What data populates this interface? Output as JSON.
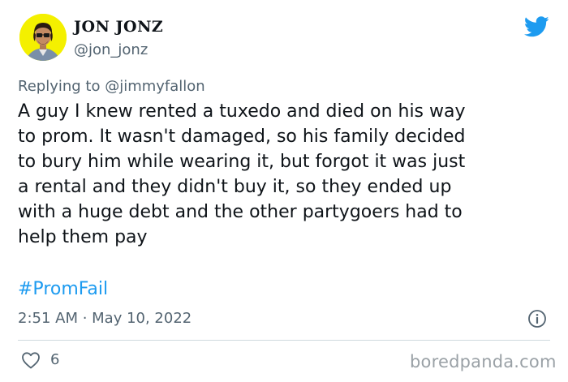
{
  "user": {
    "display_name": "JON JONZ",
    "handle": "@jon_jonz",
    "avatar_icon": "profile-avatar"
  },
  "platform_icon": "twitter-bird-icon",
  "reply": {
    "prefix": "Replying to ",
    "mention": "@jimmyfallon"
  },
  "tweet": {
    "lines": [
      "A guy I knew rented a tuxedo and died on his way",
      "to prom. It wasn't damaged, so his family decided",
      "to bury him while wearing it, but forgot it was just",
      "a rental and they didn't buy it, so they ended up",
      "with a huge debt and the other partygoers had to",
      "help them pay"
    ],
    "hashtag": "#PromFail",
    "timestamp": "2:51 AM · May 10, 2022"
  },
  "engagement": {
    "likes": "6"
  },
  "watermark": "boredpanda.com",
  "colors": {
    "text": "#0f1419",
    "secondary": "#536471",
    "link": "#1d9bf0",
    "twitter_blue": "#1d9bf0",
    "avatar_bg": "#f4f000"
  }
}
